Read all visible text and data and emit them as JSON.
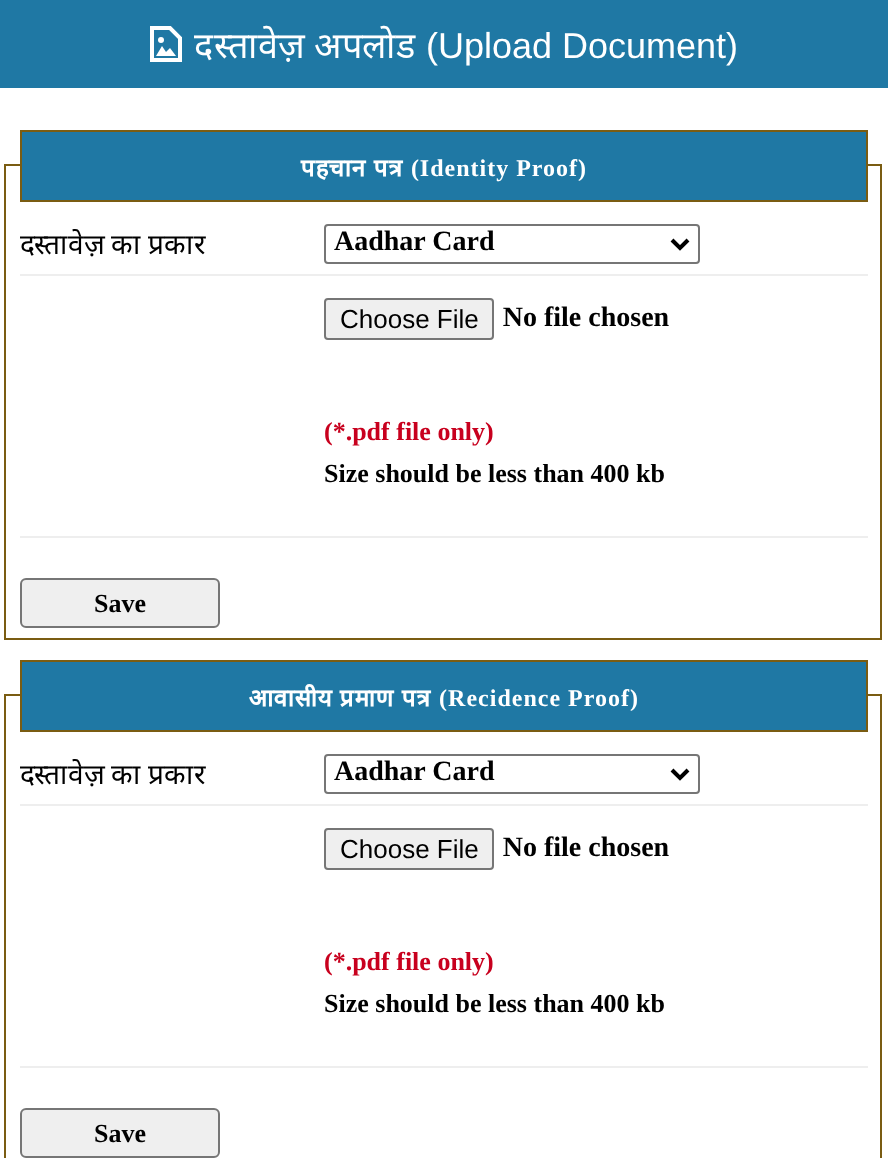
{
  "header": {
    "title": "दस्तावेज़ अपलोड (Upload Document)"
  },
  "sections": [
    {
      "title": "पहचान पत्र (Identity Proof)",
      "type_label": "दस्तावेज़ का प्रकार",
      "type_value": "Aadhar Card",
      "file_button": "Choose File",
      "file_status": "No file chosen",
      "format_note": "(*.pdf file only)",
      "size_note": "Size should be less than 400 kb",
      "save": "Save"
    },
    {
      "title": "आवासीय प्रमाण पत्र (Recidence Proof)",
      "type_label": "दस्तावेज़ का प्रकार",
      "type_value": "Aadhar Card",
      "file_button": "Choose File",
      "file_status": "No file chosen",
      "format_note": "(*.pdf file only)",
      "size_note": "Size should be less than 400 kb",
      "save": "Save"
    }
  ]
}
